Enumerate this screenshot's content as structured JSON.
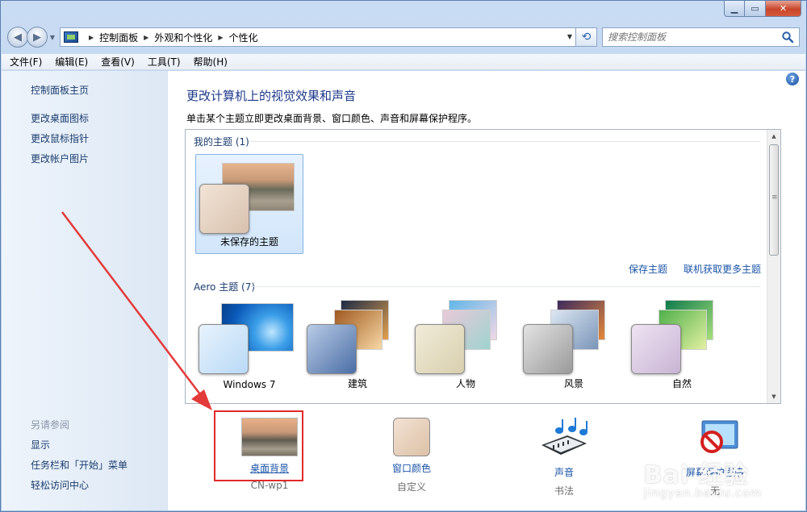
{
  "window": {
    "address": [
      "控制面板",
      "外观和个性化",
      "个性化"
    ],
    "search_placeholder": "搜索控制面板"
  },
  "menu": [
    "文件(F)",
    "编辑(E)",
    "查看(V)",
    "工具(T)",
    "帮助(H)"
  ],
  "sidebar": {
    "links": [
      "控制面板主页",
      "更改桌面图标",
      "更改鼠标指针",
      "更改帐户图片"
    ],
    "see_also_head": "另请参阅",
    "see_also": [
      "显示",
      "任务栏和「开始」菜单",
      "轻松访问中心"
    ]
  },
  "main": {
    "title": "更改计算机上的视觉效果和声音",
    "desc": "单击某个主题立即更改桌面背景、窗口颜色、声音和屏幕保护程序。",
    "my_themes_label": "我的主题 (1)",
    "unsaved_theme": "未保存的主题",
    "save_theme": "保存主题",
    "get_more": "联机获取更多主题",
    "aero_label": "Aero 主题 (7)",
    "aero_themes": [
      "Windows 7",
      "建筑",
      "人物",
      "风景",
      "自然"
    ]
  },
  "bottom": [
    {
      "label": "桌面背景",
      "sub": "CN-wp1"
    },
    {
      "label": "窗口颜色",
      "sub": "自定义"
    },
    {
      "label": "声音",
      "sub": "书法"
    },
    {
      "label": "屏幕保护程序",
      "sub": "无"
    }
  ],
  "watermark": {
    "text": "Bai 经验",
    "sub": "jingyan.baidu.com"
  },
  "colors": {
    "link": "#1b55a6",
    "title": "#1e3a8a",
    "highlight": "#e02a2a"
  }
}
